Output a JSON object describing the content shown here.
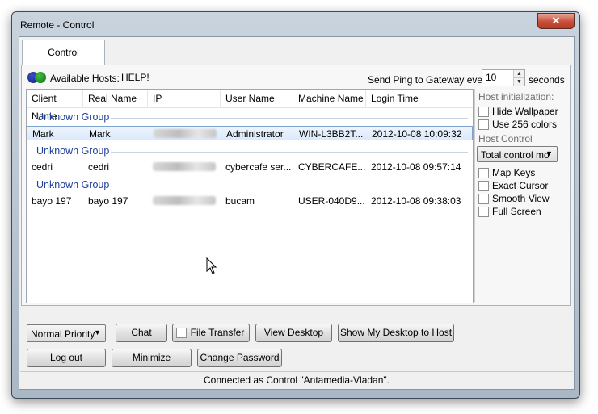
{
  "window": {
    "title": "Remote - Control",
    "close_icon": "close-icon"
  },
  "tabs": [
    {
      "label": "Control"
    }
  ],
  "hosts_bar": {
    "available_label": "Available Hosts:",
    "help_label": "HELP!",
    "ping_label": "Send Ping to Gateway every",
    "ping_value": "10",
    "ping_unit": "seconds"
  },
  "table": {
    "columns": [
      "Client Name",
      "Real Name",
      "IP",
      "User Name",
      "Machine Name",
      "Login Time"
    ],
    "groups": [
      {
        "label": "Unknown Group",
        "rows": [
          {
            "client": "Mark",
            "real": "Mark",
            "user": "Administrator",
            "machine": "WIN-L3BB2T...",
            "login": "2012-10-08 10:09:32",
            "selected": true
          }
        ]
      },
      {
        "label": "Unknown Group",
        "rows": [
          {
            "client": "cedri",
            "real": "cedri",
            "user": "cybercafe ser...",
            "machine": "CYBERCAFE...",
            "login": "2012-10-08 09:57:14",
            "selected": false
          }
        ]
      },
      {
        "label": "Unknown Group",
        "rows": [
          {
            "client": "bayo 197",
            "real": "bayo 197",
            "user": "bucam",
            "machine": "USER-040D9...",
            "login": "2012-10-08 09:38:03",
            "selected": false
          }
        ]
      }
    ]
  },
  "side_panel": {
    "init_heading": "Host initialization:",
    "init_options": [
      {
        "label": "Hide Wallpaper",
        "checked": false
      },
      {
        "label": "Use 256 colors",
        "checked": false
      }
    ],
    "control_heading": "Host Control options:",
    "control_mode": "Total control mo",
    "control_options": [
      {
        "label": "Map Keys",
        "checked": false
      },
      {
        "label": "Exact Cursor",
        "checked": false
      },
      {
        "label": "Smooth View",
        "checked": false
      },
      {
        "label": "Full Screen",
        "checked": false
      }
    ]
  },
  "toolbar": {
    "priority": "Normal Priority",
    "chat": "Chat",
    "file_transfer": "File Transfer",
    "view_desktop": "View Desktop",
    "show_desktop": "Show My Desktop to Host",
    "logout": "Log out",
    "minimize": "Minimize",
    "change_password": "Change Password"
  },
  "status": "Connected as Control \"Antamedia-Vladan\"."
}
